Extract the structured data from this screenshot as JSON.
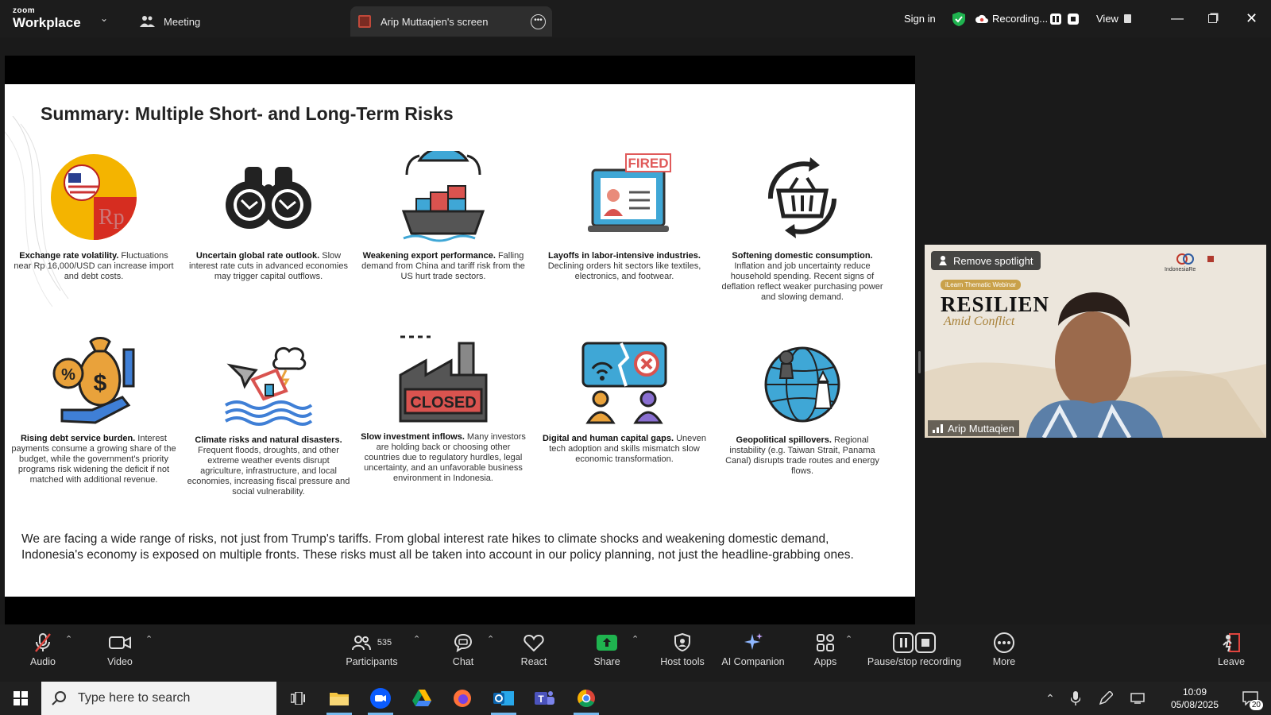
{
  "app": {
    "logo_top": "zoom",
    "logo_bottom": "Workplace",
    "meeting_tab": "Meeting",
    "screen_tab": "Arip Muttaqien's screen",
    "sign_in": "Sign in",
    "recording": "Recording...",
    "view": "View"
  },
  "slide": {
    "title": "Summary: Multiple Short- and Long-Term Risks",
    "cards": [
      {
        "bold": "Exchange rate volatility.",
        "text": " Fluctuations near Rp 16,000/USD can increase import and debt costs.",
        "icon": "currency-icon"
      },
      {
        "bold": "Uncertain global rate outlook.",
        "text": " Slow interest rate cuts in advanced economies may trigger capital outflows.",
        "icon": "binoculars-icon"
      },
      {
        "bold": "Weakening export performance.",
        "text": " Falling demand from China and tariff risk from the US hurt trade sectors.",
        "icon": "cargo-ship-icon"
      },
      {
        "bold": "Layoffs in labor-intensive industries.",
        "text": " Declining orders hit sectors like textiles, electronics, and footwear.",
        "icon": "fired-icon"
      },
      {
        "bold": "Softening domestic consumption.",
        "text": " Inflation and job uncertainty reduce household spending. Recent signs of deflation reflect weaker purchasing power and slowing demand.",
        "icon": "basket-cycle-icon"
      },
      {
        "bold": "Rising debt service burden.",
        "text": " Interest payments consume a growing share of the budget, while the government's priority programs risk widening the deficit if not matched with additional revenue.",
        "icon": "money-bag-icon"
      },
      {
        "bold": "Climate risks and natural disasters.",
        "text": " Frequent floods, droughts, and other extreme weather events disrupt agriculture, infrastructure, and local economies, increasing fiscal pressure and social vulnerability.",
        "icon": "disaster-icon"
      },
      {
        "bold": "Slow investment inflows.",
        "text": " Many investors are holding back or choosing other countries due to regulatory hurdles, legal uncertainty, and an unfavorable business environment in Indonesia.",
        "icon": "closed-factory-icon"
      },
      {
        "bold": "Digital and human capital gaps.",
        "text": " Uneven tech adoption and skills mismatch slow economic transformation.",
        "icon": "digital-gap-icon"
      },
      {
        "bold": "Geopolitical spillovers.",
        "text": " Regional instability (e.g. Taiwan Strait, Panama Canal) disrupts trade routes and energy flows.",
        "icon": "globe-chess-icon"
      }
    ],
    "summary": "We are facing a wide range of risks, not just from Trump's tariffs. From global interest rate hikes to climate shocks and weakening domestic demand, Indonesia's economy is exposed on multiple fronts. These risks must all be taken into account in our policy planning, not just the headline-grabbing ones.",
    "icon_labels": {
      "fired": "FIRED",
      "closed": "CLOSED"
    }
  },
  "video": {
    "spotlight": "Remove spotlight",
    "name": "Arip Muttaqien",
    "banner_small": "iLearn Thematic Webinar",
    "banner_big": "RESILIEN",
    "banner_script": "Amid Conflict",
    "logo_text": "IndonesiaRe"
  },
  "toolbar": {
    "audio": "Audio",
    "video": "Video",
    "participants": "Participants",
    "participants_count": "535",
    "chat": "Chat",
    "react": "React",
    "share": "Share",
    "host_tools": "Host tools",
    "ai_companion": "AI Companion",
    "apps": "Apps",
    "pause_stop": "Pause/stop recording",
    "more": "More",
    "leave": "Leave"
  },
  "taskbar": {
    "search_placeholder": "Type here to search",
    "time": "10:09",
    "date": "05/08/2025",
    "notifications": "20"
  },
  "colors": {
    "accent_green": "#1fb34f",
    "zoom_blue": "#0b5cff",
    "leave_red": "#e0443e"
  }
}
